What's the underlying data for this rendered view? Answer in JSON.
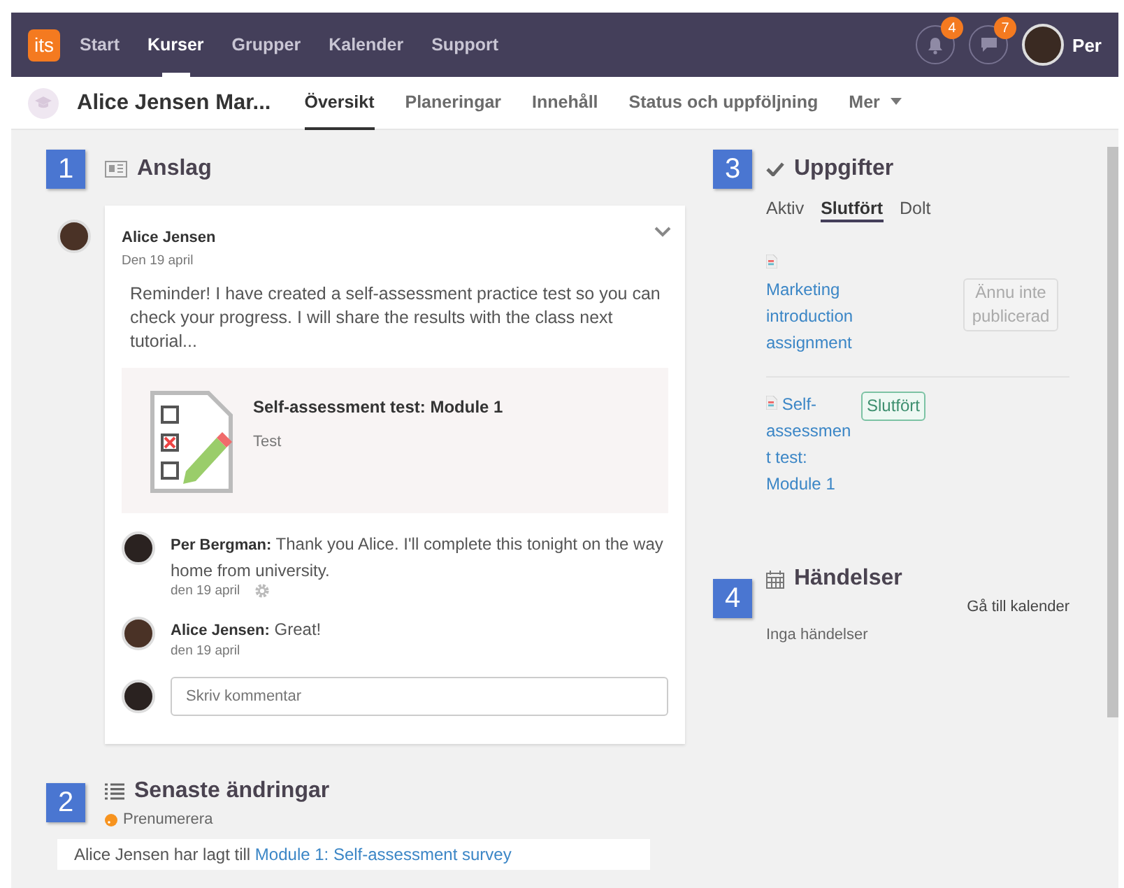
{
  "nav": {
    "logo": "its",
    "items": [
      {
        "label": "Start",
        "selected": false
      },
      {
        "label": "Kurser",
        "selected": true
      },
      {
        "label": "Grupper",
        "selected": false
      },
      {
        "label": "Kalender",
        "selected": false
      },
      {
        "label": "Support",
        "selected": false
      }
    ],
    "notifications": "4",
    "messages": "7",
    "user": "Per"
  },
  "course": {
    "title": "Alice Jensen Mar...",
    "tabs": [
      {
        "label": "Översikt",
        "selected": true
      },
      {
        "label": "Planeringar",
        "selected": false
      },
      {
        "label": "Innehåll",
        "selected": false
      },
      {
        "label": "Status och uppföljning",
        "selected": false
      }
    ],
    "more": "Mer"
  },
  "announcements": {
    "marker": "1",
    "title": "Anslag",
    "post": {
      "author": "Alice Jensen",
      "date": "Den 19 april",
      "body": "Reminder! I have created a self-assessment practice test so you can check your progress. I will share the results with the class next tutorial...",
      "attachment": {
        "title": "Self-assessment test: Module 1",
        "type": "Test"
      }
    },
    "comments": [
      {
        "author": "Per Bergman:",
        "text": "Thank you Alice. I'll complete this tonight on the way home from university.",
        "date": "den 19 april",
        "settings_icon": true
      },
      {
        "author": "Alice Jensen:",
        "text": "Great!",
        "date": "den 19 april",
        "settings_icon": false
      }
    ],
    "comment_field": {
      "placeholder": "Skriv kommentar"
    }
  },
  "changes": {
    "marker": "2",
    "title": "Senaste ändringar",
    "subscribe": "Prenumerera",
    "entry": {
      "text": "Alice Jensen har lagt till",
      "link": "Module 1: Self-assessment survey"
    }
  },
  "assignments": {
    "marker": "3",
    "title": "Uppgifter",
    "tabs": [
      {
        "label": "Aktiv",
        "selected": false
      },
      {
        "label": "Slutfört",
        "selected": true
      },
      {
        "label": "Dolt",
        "selected": false
      }
    ],
    "items": [
      {
        "title": "Marketing introduction assignment",
        "status": "Ännu inte publicerad",
        "kind": "unpublished"
      },
      {
        "title": "Self-assessment test: Module 1",
        "status": "Slutfört",
        "kind": "completed"
      }
    ]
  },
  "events": {
    "marker": "4",
    "title": "Händelser",
    "calendar_link": "Gå till kalender",
    "empty": "Inga händelser"
  }
}
